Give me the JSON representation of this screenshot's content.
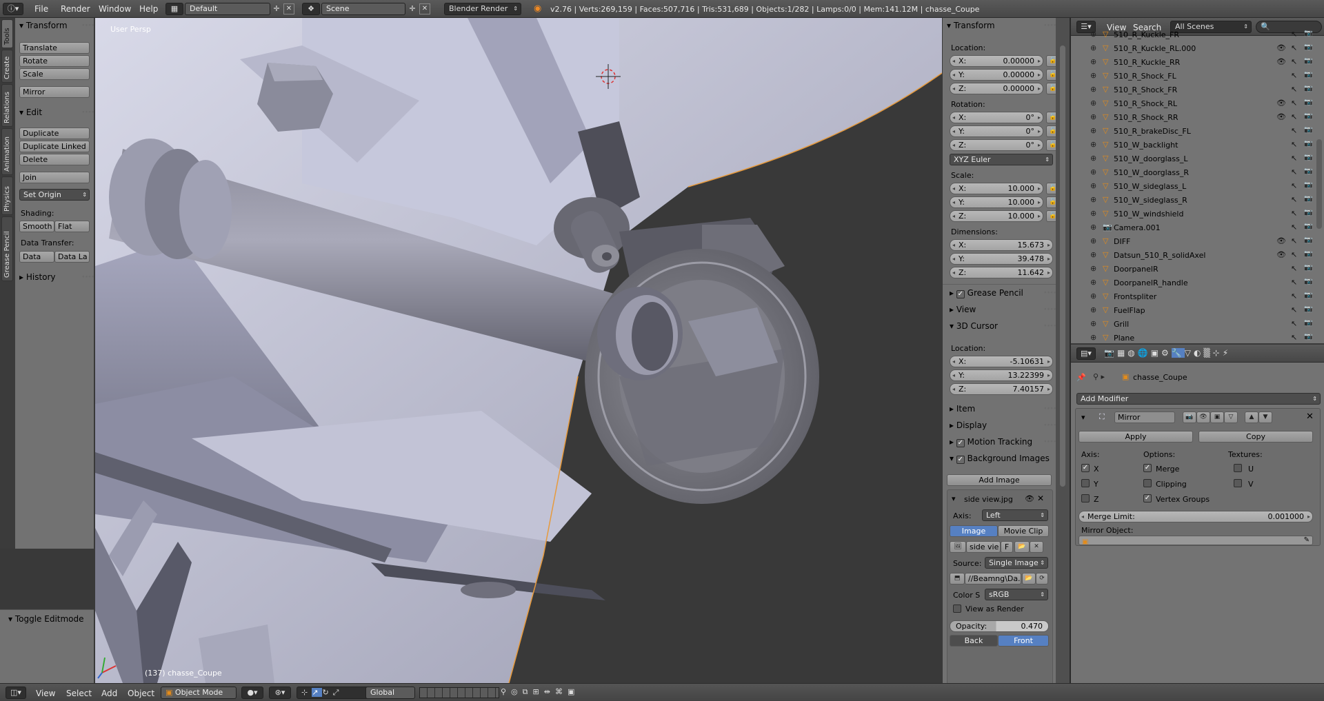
{
  "topbar": {
    "info_icon": "info-icon",
    "menus": [
      "File",
      "Render",
      "Window",
      "Help"
    ],
    "screen_layout": "Default",
    "scene": "Scene",
    "render_engine": "Blender Render",
    "stats": "v2.76 | Verts:269,159 | Faces:507,716 | Tris:531,689 | Objects:1/282 | Lamps:0/0 | Mem:141.12M | chasse_Coupe"
  },
  "toolshelf": {
    "tabs": [
      "Tools",
      "Create",
      "Relations",
      "Animation",
      "Physics",
      "Grease Pencil"
    ],
    "transform_header": "Transform",
    "translate": "Translate",
    "rotate": "Rotate",
    "scale": "Scale",
    "mirror": "Mirror",
    "edit_header": "Edit",
    "duplicate": "Duplicate",
    "duplicate_linked": "Duplicate Linked",
    "delete": "Delete",
    "join": "Join",
    "set_origin": "Set Origin",
    "shading_label": "Shading:",
    "smooth": "Smooth",
    "flat": "Flat",
    "data_transfer_label": "Data Transfer:",
    "data": "Data",
    "data_layers": "Data La",
    "history_header": "History",
    "toggle_editmode": "Toggle Editmode"
  },
  "viewport": {
    "view_name": "User Persp",
    "object_info": "(137) chasse_Coupe"
  },
  "npanel": {
    "transform_header": "Transform",
    "location_label": "Location:",
    "location": [
      {
        "axis": "X:",
        "value": "0.00000"
      },
      {
        "axis": "Y:",
        "value": "0.00000"
      },
      {
        "axis": "Z:",
        "value": "0.00000"
      }
    ],
    "rotation_label": "Rotation:",
    "rotation": [
      {
        "axis": "X:",
        "value": "0°"
      },
      {
        "axis": "Y:",
        "value": "0°"
      },
      {
        "axis": "Z:",
        "value": "0°"
      }
    ],
    "rotation_mode": "XYZ Euler",
    "scale_label": "Scale:",
    "scale": [
      {
        "axis": "X:",
        "value": "10.000"
      },
      {
        "axis": "Y:",
        "value": "10.000"
      },
      {
        "axis": "Z:",
        "value": "10.000"
      }
    ],
    "dimensions_label": "Dimensions:",
    "dimensions": [
      {
        "axis": "X:",
        "value": "15.673"
      },
      {
        "axis": "Y:",
        "value": "39.478"
      },
      {
        "axis": "Z:",
        "value": "11.642"
      }
    ],
    "grease_pencil": "Grease Pencil",
    "view": "View",
    "cursor_header": "3D Cursor",
    "cursor_location_label": "Location:",
    "cursor": [
      {
        "axis": "X:",
        "value": "-5.10631"
      },
      {
        "axis": "Y:",
        "value": "13.22399"
      },
      {
        "axis": "Z:",
        "value": "7.40157"
      }
    ],
    "item": "Item",
    "display": "Display",
    "motion_tracking": "Motion Tracking",
    "background_images": "Background Images",
    "add_image": "Add Image",
    "bg_image_name": "side view.jpg",
    "axis_label": "Axis:",
    "axis_value": "Left",
    "image_tab": "Image",
    "movie_clip_tab": "Movie Clip",
    "image_datablock": "side vie",
    "fake_user": "F",
    "source_label": "Source:",
    "source_value": "Single Image",
    "filepath": "//Beamng\\Da...",
    "color_space_label": "Color S",
    "color_space_value": "sRGB",
    "view_as_render": "View as Render",
    "opacity_label": "Opacity:",
    "opacity_value": "0.470",
    "back": "Back",
    "front": "Front"
  },
  "outliner": {
    "menu_view": "View",
    "menu_search": "Search",
    "display_mode": "All Scenes",
    "rows": [
      {
        "name": "510_R_Kuckle_FR",
        "icon": "mesh-object-icon"
      },
      {
        "name": "510_R_Kuckle_RL.000",
        "icon": "mesh-object-icon"
      },
      {
        "name": "510_R_Kuckle_RR",
        "icon": "mesh-object-icon"
      },
      {
        "name": "510_R_Shock_FL",
        "icon": "mesh-object-icon"
      },
      {
        "name": "510_R_Shock_FR",
        "icon": "mesh-object-icon"
      },
      {
        "name": "510_R_Shock_RL",
        "icon": "mesh-object-icon"
      },
      {
        "name": "510_R_Shock_RR",
        "icon": "mesh-object-icon"
      },
      {
        "name": "510_R_brakeDisc_FL",
        "icon": "mesh-object-icon"
      },
      {
        "name": "510_W_backlight",
        "icon": "mesh-object-icon"
      },
      {
        "name": "510_W_doorglass_L",
        "icon": "mesh-object-icon"
      },
      {
        "name": "510_W_doorglass_R",
        "icon": "mesh-object-icon"
      },
      {
        "name": "510_W_sideglass_L",
        "icon": "mesh-object-icon"
      },
      {
        "name": "510_W_sideglass_R",
        "icon": "mesh-object-icon"
      },
      {
        "name": "510_W_windshield",
        "icon": "mesh-object-icon"
      },
      {
        "name": "Camera.001",
        "icon": "camera-object-icon"
      },
      {
        "name": "DIFF",
        "icon": "mesh-object-icon"
      },
      {
        "name": "Datsun_510_R_solidAxel",
        "icon": "mesh-object-icon"
      },
      {
        "name": "DoorpanelR",
        "icon": "mesh-object-icon"
      },
      {
        "name": "DoorpanelR_handle",
        "icon": "mesh-object-icon"
      },
      {
        "name": "Frontspliter",
        "icon": "mesh-object-icon"
      },
      {
        "name": "FuelFlap",
        "icon": "mesh-object-icon"
      },
      {
        "name": "Grill",
        "icon": "mesh-object-icon"
      },
      {
        "name": "Plane",
        "icon": "mesh-object-icon"
      }
    ]
  },
  "properties": {
    "object_name": "chasse_Coupe",
    "add_modifier": "Add Modifier",
    "modifier_name": "Mirror",
    "apply": "Apply",
    "copy": "Copy",
    "axis_label": "Axis:",
    "options_label": "Options:",
    "textures_label": "Textures:",
    "x": "X",
    "y": "Y",
    "z": "Z",
    "merge": "Merge",
    "clipping": "Clipping",
    "vertex_groups": "Vertex Groups",
    "u": "U",
    "v": "V",
    "merge_limit_label": "Merge Limit:",
    "merge_limit_value": "0.001000",
    "mirror_object_label": "Mirror Object:"
  },
  "bottombar": {
    "menus": [
      "View",
      "Select",
      "Add",
      "Object"
    ],
    "mode": "Object Mode",
    "orientation": "Global"
  },
  "colors": {
    "accent_blue": "#5680c2",
    "panel_grey": "#727272",
    "header_dark": "#474747",
    "object_orange": "#e38b1a"
  }
}
